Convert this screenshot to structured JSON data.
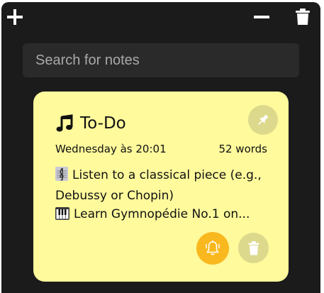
{
  "toolbar": {
    "add_icon": "plus-icon",
    "minimize_icon": "minus-icon",
    "delete_icon": "trash-icon"
  },
  "search": {
    "placeholder": "Search for notes",
    "value": ""
  },
  "note": {
    "title_icon": "music-note-icon",
    "title": "To-Do",
    "date": "Wednesday às 20:01",
    "word_count": "52 words",
    "lines": [
      {
        "icon": "treble-clef-icon",
        "text": "Listen to a classical piece (e.g.,"
      },
      {
        "icon": "",
        "text": "Debussy or Chopin)"
      },
      {
        "icon": "piano-keys-icon",
        "text": "Learn Gymnopédie No.1 on..."
      }
    ],
    "background_color": "#fffa9c",
    "pin_icon": "pin-icon",
    "reminder_icon": "bell-icon",
    "reminder_color": "#f9b81e",
    "delete_icon": "trash-icon"
  },
  "colors": {
    "window_bg": "#1b1b1b",
    "search_bg": "#2a2a2a"
  }
}
